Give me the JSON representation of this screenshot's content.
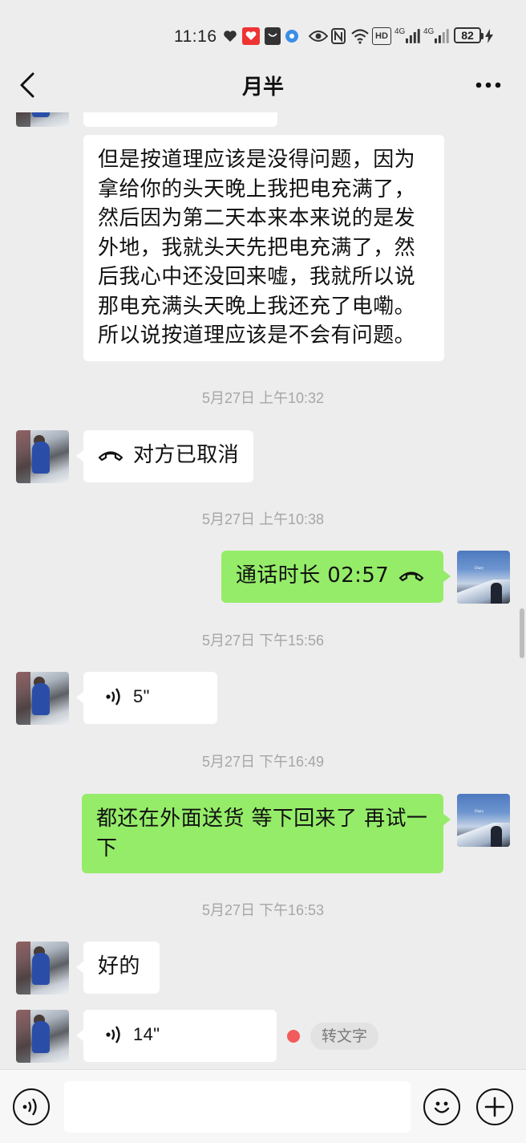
{
  "status_bar": {
    "time": "11:16",
    "network_1": "4G",
    "network_2": "4G",
    "hd_label": "HD",
    "battery": "82"
  },
  "header": {
    "title": "月半",
    "back_icon": "chevron-left-icon",
    "more_icon": "more-dots-icon"
  },
  "messages": [
    {
      "side": "left",
      "type": "text",
      "text": "但是按道理应该是没得问题，因为拿给你的头天晚上我把电充满了，然后因为第二天本来本来说的是发外地，我就头天先把电充满了，然后我心中还没回来嘘，我就所以说那电充满头天晚上我还充了电嘞。所以说按道理应该是不会有问题。"
    },
    {
      "type": "timestamp",
      "text": "5月27日 上午10:32"
    },
    {
      "side": "left",
      "type": "call",
      "text": "对方已取消",
      "icon": "phone-hangup-icon"
    },
    {
      "type": "timestamp",
      "text": "5月27日 上午10:38"
    },
    {
      "side": "right",
      "type": "call",
      "text": "通话时长 02:57",
      "icon": "phone-hangup-icon"
    },
    {
      "type": "timestamp",
      "text": "5月27日 下午15:56"
    },
    {
      "side": "left",
      "type": "voice",
      "duration": "5\"",
      "icon": "voice-wave-icon"
    },
    {
      "type": "timestamp",
      "text": "5月27日 下午16:49"
    },
    {
      "side": "right",
      "type": "text",
      "text": "都还在外面送货 等下回来了 再试一下"
    },
    {
      "type": "timestamp",
      "text": "5月27日 下午16:53"
    },
    {
      "side": "left",
      "type": "text",
      "text": "好的"
    },
    {
      "side": "left",
      "type": "voice",
      "duration": "14\"",
      "icon": "voice-wave-icon",
      "unread": true,
      "transcribe_label": "转文字"
    }
  ],
  "input_bar": {
    "voice_icon": "voice-mode-icon",
    "input_value": "",
    "emoji_icon": "emoji-icon",
    "add_icon": "plus-icon"
  },
  "colors": {
    "background": "#ededed",
    "bubble_self": "#95ec69",
    "bubble_other": "#ffffff",
    "timestamp": "#a6a6a6",
    "unread_dot": "#f25b5b"
  }
}
